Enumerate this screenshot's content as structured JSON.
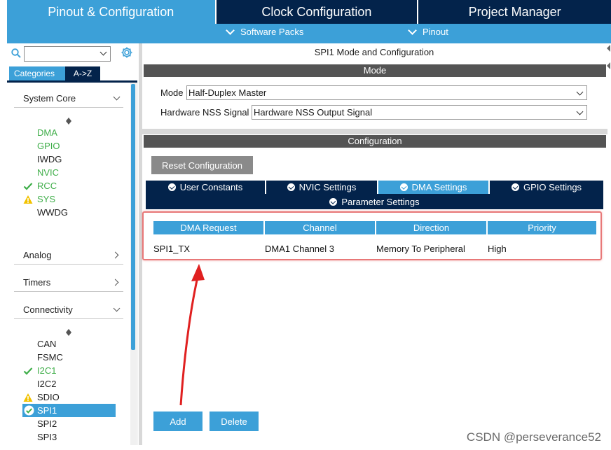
{
  "top_tabs": [
    "Pinout & Configuration",
    "Clock Configuration",
    "Project Manager"
  ],
  "subbar": {
    "software_packs": "Software Packs",
    "pinout": "Pinout"
  },
  "left": {
    "search_value": "",
    "cat_tabs": [
      "Categories",
      "A->Z"
    ],
    "sections": {
      "system_core": "System Core",
      "analog": "Analog",
      "timers": "Timers",
      "connectivity": "Connectivity"
    },
    "system_core_items": [
      {
        "label": "DMA",
        "state": "green"
      },
      {
        "label": "GPIO",
        "state": "green"
      },
      {
        "label": "IWDG",
        "state": "plain"
      },
      {
        "label": "NVIC",
        "state": "green"
      },
      {
        "label": "RCC",
        "state": "check"
      },
      {
        "label": "SYS",
        "state": "warn"
      },
      {
        "label": "WWDG",
        "state": "plain"
      }
    ],
    "connectivity_items": [
      {
        "label": "CAN",
        "state": "plain"
      },
      {
        "label": "FSMC",
        "state": "plain"
      },
      {
        "label": "I2C1",
        "state": "check"
      },
      {
        "label": "I2C2",
        "state": "plain"
      },
      {
        "label": "SDIO",
        "state": "warn"
      },
      {
        "label": "SPI1",
        "state": "selected"
      },
      {
        "label": "SPI2",
        "state": "plain"
      },
      {
        "label": "SPI3",
        "state": "plain"
      }
    ]
  },
  "right": {
    "title": "SPI1 Mode and Configuration",
    "mode_bar": "Mode",
    "mode_label": "Mode",
    "mode_value": "Half-Duplex Master",
    "nss_label": "Hardware NSS Signal",
    "nss_value": "Hardware NSS Output Signal",
    "config_bar": "Configuration",
    "reset_button": "Reset Configuration",
    "tabs": [
      "User Constants",
      "NVIC Settings",
      "DMA Settings",
      "GPIO Settings",
      "Parameter Settings"
    ],
    "active_tab": "DMA Settings",
    "table": {
      "headers": [
        "DMA Request",
        "Channel",
        "Direction",
        "Priority"
      ],
      "rows": [
        [
          "SPI1_TX",
          "DMA1 Channel 3",
          "Memory To Peripheral",
          "High"
        ]
      ]
    },
    "add_button": "Add",
    "delete_button": "Delete"
  },
  "watermark": "CSDN @perseverance52",
  "colors": {
    "accent": "#3ca0d8",
    "navy": "#03234b",
    "green": "#3fae49",
    "bar": "#545454",
    "highlight": "#e87878"
  }
}
